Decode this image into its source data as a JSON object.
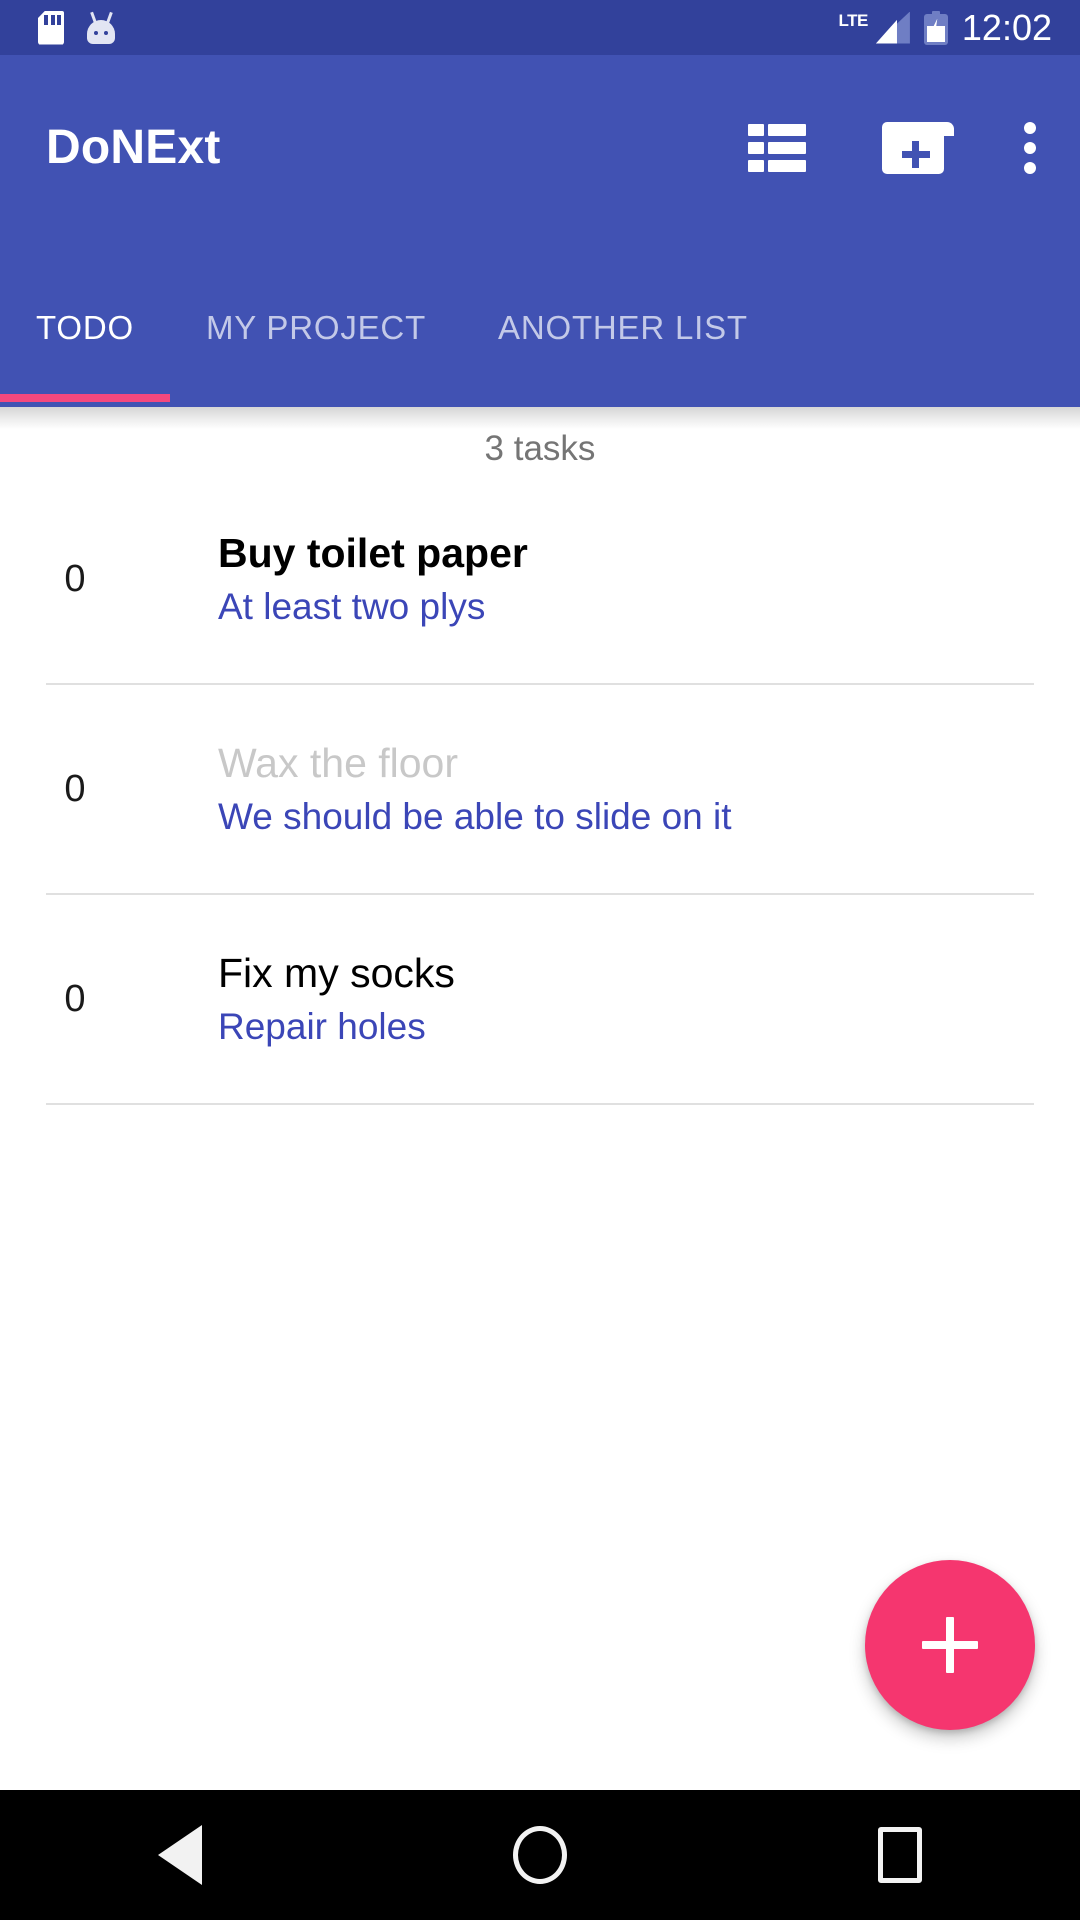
{
  "status_bar": {
    "icons": [
      "sd-card-icon",
      "android-head-icon"
    ],
    "network_label": "LTE",
    "battery_state": "charging",
    "time": "12:02",
    "background_color": "#32419b"
  },
  "app_bar": {
    "title": "DoNExt",
    "background_color": "#4152b3",
    "actions": [
      {
        "name": "list-view-icon",
        "label": "List view"
      },
      {
        "name": "new-folder-icon",
        "label": "New list"
      },
      {
        "name": "overflow-menu-icon",
        "label": "More options"
      }
    ]
  },
  "tabs": {
    "active_index": 0,
    "indicator_color": "#f4487e",
    "items": [
      {
        "label": "TODO"
      },
      {
        "label": "MY PROJECT"
      },
      {
        "label": "ANOTHER LIST"
      }
    ]
  },
  "main": {
    "task_count_label": "3 tasks",
    "tasks": [
      {
        "badge": "0",
        "title": "Buy toilet paper",
        "note": "At least two plys",
        "style": "bold"
      },
      {
        "badge": "0",
        "title": "Wax the floor",
        "note": "We should be able to slide on it",
        "style": "dimmed"
      },
      {
        "badge": "0",
        "title": "Fix my socks",
        "note": "Repair holes",
        "style": "normal"
      }
    ],
    "note_color": "#3b46b7"
  },
  "fab": {
    "name": "add-task-fab",
    "icon": "plus-icon",
    "color": "#f5366f"
  },
  "nav_bar": {
    "buttons": [
      {
        "name": "nav-back-button",
        "icon": "triangle-back-icon"
      },
      {
        "name": "nav-home-button",
        "icon": "circle-home-icon"
      },
      {
        "name": "nav-recents-button",
        "icon": "square-recents-icon"
      }
    ],
    "background_color": "#000000"
  }
}
